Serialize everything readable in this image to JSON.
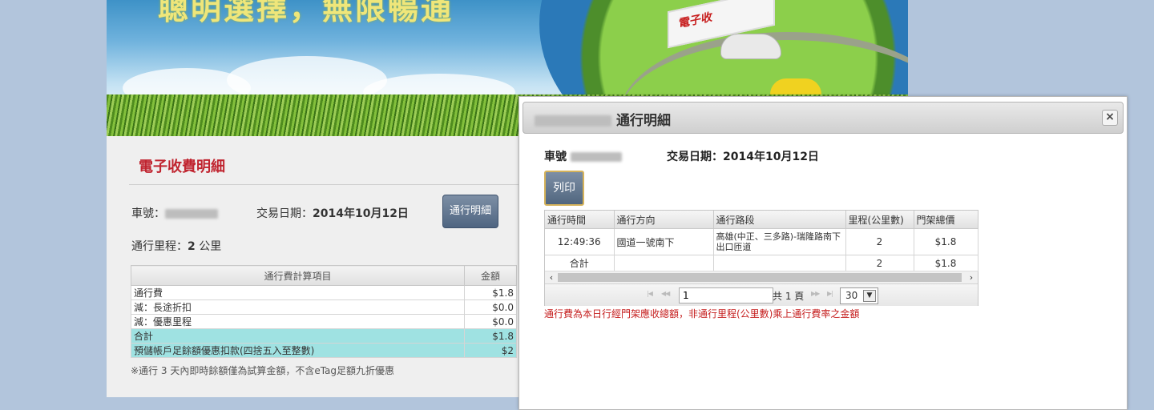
{
  "banner": {
    "title": "聰明選擇，無限暢通",
    "sign_text": "電子收"
  },
  "fee_detail": {
    "header": "電子收費明細",
    "plate_label": "車號：",
    "date_label": "交易日期：",
    "date_value": "2014年10月12日",
    "detail_button": "通行明細",
    "mileage_label": "通行里程：",
    "mileage_value": "2",
    "mileage_unit": "公里",
    "table": {
      "headers": [
        "通行費計算項目",
        "金額"
      ],
      "rows": [
        {
          "item": "通行費",
          "amount": "$1.8"
        },
        {
          "item": "減：長途折扣",
          "amount": "$0.0"
        },
        {
          "item": "減：優惠里程",
          "amount": "$0.0"
        },
        {
          "item": "合計",
          "amount": "$1.8"
        },
        {
          "item": "預儲帳戶足餘額優惠扣款(四捨五入至整數)",
          "amount": "$2"
        }
      ]
    },
    "note": "※通行 3 天內即時餘額僅為試算金額，不含eTag足額九折優惠"
  },
  "dialog": {
    "title": "通行明細",
    "plate_label": "車號",
    "date_label": "交易日期：",
    "date_value": "2014年10月12日",
    "print_button": "列印",
    "grid": {
      "headers": [
        "通行時間",
        "通行方向",
        "通行路段",
        "里程(公里數)",
        "門架總價"
      ],
      "rows": [
        {
          "time": "12:49:36",
          "direction": "國道一號南下",
          "segment": "高雄(中正、三多路)-瑞隆路南下出口匝道",
          "km": "2",
          "price": "$1.8"
        },
        {
          "time": "合計",
          "direction": "",
          "segment": "",
          "km": "2",
          "price": "$1.8"
        }
      ]
    },
    "pager": {
      "page": "1",
      "total_text": "共 1 頁",
      "page_size": "30"
    },
    "note": "通行費為本日行經門架應收總額，非通行里程(公里數)乘上通行費率之金額"
  }
}
